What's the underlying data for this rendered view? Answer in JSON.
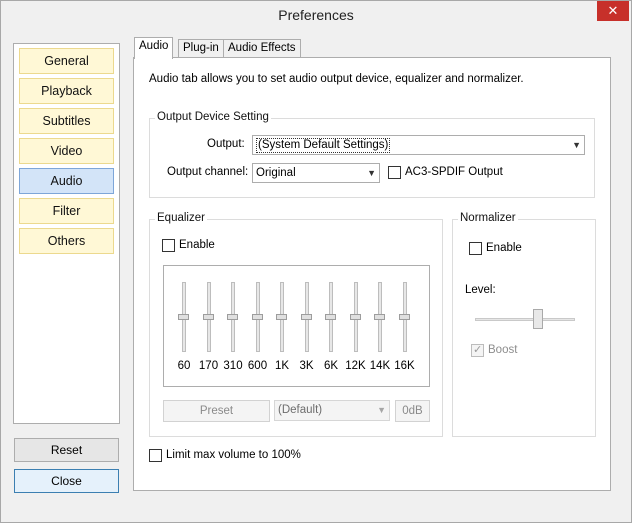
{
  "window": {
    "title": "Preferences",
    "close_glyph": "✕"
  },
  "nav": {
    "items": [
      {
        "label": "General",
        "active": false
      },
      {
        "label": "Playback",
        "active": false
      },
      {
        "label": "Subtitles",
        "active": false
      },
      {
        "label": "Video",
        "active": false
      },
      {
        "label": "Audio",
        "active": true
      },
      {
        "label": "Filter",
        "active": false
      },
      {
        "label": "Others",
        "active": false
      }
    ],
    "reset_label": "Reset",
    "close_label": "Close"
  },
  "tabs": [
    {
      "label": "Audio",
      "selected": true
    },
    {
      "label": "Plug-in",
      "selected": false
    },
    {
      "label": "Audio Effects",
      "selected": false
    }
  ],
  "audio": {
    "description": "Audio tab allows you to set audio output device, equalizer and normalizer.",
    "output_device": {
      "group_label": "Output Device Setting",
      "output_label": "Output:",
      "output_value": "(System Default Settings)",
      "channel_label": "Output channel:",
      "channel_value": "Original",
      "ac3_label": "AC3-SPDIF Output",
      "ac3_checked": false
    },
    "equalizer": {
      "group_label": "Equalizer",
      "enable_label": "Enable",
      "enabled": false,
      "bands": [
        {
          "label": "60",
          "level": 0.5
        },
        {
          "label": "170",
          "level": 0.5
        },
        {
          "label": "310",
          "level": 0.5
        },
        {
          "label": "600",
          "level": 0.5
        },
        {
          "label": "1K",
          "level": 0.5
        },
        {
          "label": "3K",
          "level": 0.5
        },
        {
          "label": "6K",
          "level": 0.5
        },
        {
          "label": "12K",
          "level": 0.5
        },
        {
          "label": "14K",
          "level": 0.5
        },
        {
          "label": "16K",
          "level": 0.5
        }
      ],
      "preset_label": "Preset",
      "preset_value": "(Default)",
      "db_label": "0dB"
    },
    "normalizer": {
      "group_label": "Normalizer",
      "enable_label": "Enable",
      "enabled": false,
      "level_label": "Level:",
      "level_value": 0.7,
      "boost_label": "Boost",
      "boost_checked": true
    },
    "limit_label": "Limit max volume to 100%",
    "limit_checked": false
  },
  "colors": {
    "nav_item_bg": "#fff8d6",
    "nav_item_active_bg": "#d3e4f8",
    "close_button_red": "#c7302a"
  }
}
